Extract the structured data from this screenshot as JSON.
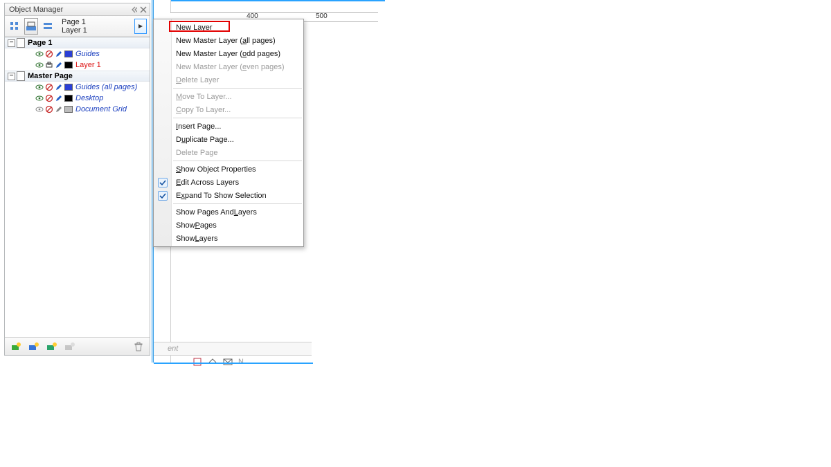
{
  "panel": {
    "title": "Object Manager",
    "page_label": "Page 1",
    "layer_label": "Layer 1"
  },
  "tree": {
    "page_header": "Page 1",
    "guides": "Guides",
    "layer1": "Layer 1",
    "master_header": "Master Page",
    "guides_all": "Guides (all pages)",
    "desktop": "Desktop",
    "doc_grid": "Document Grid"
  },
  "ruler": {
    "t400": "400",
    "t500": "500"
  },
  "bottom": {
    "hint": "ent",
    "letter": "N"
  },
  "menu": {
    "new_layer_pre": "",
    "new_layer_u": "N",
    "new_layer_post": "ew Layer",
    "nm_all_pre": "New Master Layer (",
    "nm_all_u": "a",
    "nm_all_post": "ll pages)",
    "nm_odd_pre": "New Master Layer (",
    "nm_odd_u": "o",
    "nm_odd_post": "dd pages)",
    "nm_even_pre": "New Master Layer (",
    "nm_even_u": "e",
    "nm_even_post": "ven pages)",
    "del_layer_pre": "",
    "del_layer_u": "D",
    "del_layer_post": "elete Layer",
    "move_to_pre": "",
    "move_to_u": "M",
    "move_to_post": "ove To Layer...",
    "copy_to_pre": "",
    "copy_to_u": "C",
    "copy_to_post": "opy To Layer...",
    "ins_page_pre": "",
    "ins_page_u": "I",
    "ins_page_post": "nsert Page...",
    "dup_page_pre": "D",
    "dup_page_u": "u",
    "dup_page_post": "plicate Page...",
    "del_page": "Delete Page",
    "show_prop_pre": "",
    "show_prop_u": "S",
    "show_prop_post": "how Object Properties",
    "edit_across_pre": "",
    "edit_across_u": "E",
    "edit_across_post": "dit Across Layers",
    "expand_sel_pre": "E",
    "expand_sel_u": "x",
    "expand_sel_post": "pand To Show Selection",
    "show_pl_pre": "Show Pages And ",
    "show_pl_u": "L",
    "show_pl_post": "ayers",
    "show_p_pre": "Show ",
    "show_p_u": "P",
    "show_p_post": "ages",
    "show_l_pre": "Show ",
    "show_l_u": "L",
    "show_l_post": "ayers"
  }
}
